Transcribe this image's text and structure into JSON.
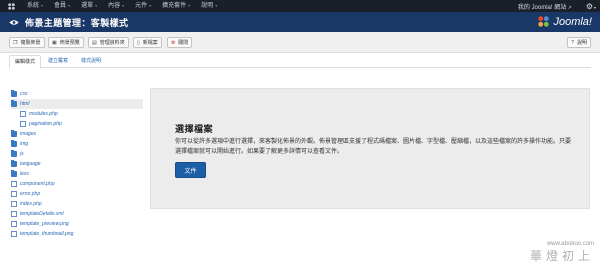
{
  "topbar": {
    "menu": [
      "系統",
      "會員",
      "選單",
      "內容",
      "元件",
      "擴充套件",
      "說明"
    ],
    "site_link": "我的 Joomla! 網站"
  },
  "header": {
    "title": "佈景主題管理：客製樣式",
    "brand": "Joomla!"
  },
  "toolbar": {
    "buttons": [
      {
        "icon": "copy-icon",
        "label": "複製佈景"
      },
      {
        "icon": "preview-icon",
        "label": "佈景預覽"
      },
      {
        "icon": "folder-icon",
        "label": "管理資料夾"
      },
      {
        "icon": "new-file-icon",
        "label": "新檔案"
      },
      {
        "icon": "close-icon",
        "label": "關閉"
      }
    ],
    "help": "說明"
  },
  "tabs": [
    "編輯樣式",
    "建立覆寫",
    "樣式說明"
  ],
  "tree": [
    {
      "type": "folder",
      "name": "css",
      "depth": 0,
      "selected": false
    },
    {
      "type": "folder",
      "name": "html",
      "depth": 0,
      "selected": true
    },
    {
      "type": "file",
      "name": "modules.php",
      "depth": 1,
      "selected": false
    },
    {
      "type": "file",
      "name": "pagination.php",
      "depth": 1,
      "selected": false
    },
    {
      "type": "folder",
      "name": "images",
      "depth": 0,
      "selected": false
    },
    {
      "type": "folder",
      "name": "img",
      "depth": 0,
      "selected": false
    },
    {
      "type": "folder",
      "name": "js",
      "depth": 0,
      "selected": false
    },
    {
      "type": "folder",
      "name": "language",
      "depth": 0,
      "selected": false
    },
    {
      "type": "folder",
      "name": "less",
      "depth": 0,
      "selected": false
    },
    {
      "type": "file",
      "name": "component.php",
      "depth": 0,
      "selected": false
    },
    {
      "type": "file",
      "name": "error.php",
      "depth": 0,
      "selected": false
    },
    {
      "type": "file",
      "name": "index.php",
      "depth": 0,
      "selected": false
    },
    {
      "type": "file",
      "name": "templateDetails.xml",
      "depth": 0,
      "selected": false
    },
    {
      "type": "file",
      "name": "template_preview.png",
      "depth": 0,
      "selected": false
    },
    {
      "type": "file",
      "name": "template_thumbnail.png",
      "depth": 0,
      "selected": false
    }
  ],
  "panel": {
    "heading": "選擇檔案",
    "body": "你可以從許多選項中進行選擇，來客製化佈景的外觀。佈景管理區支援了程式碼檔案、圖片檔、字型檔、壓縮檔，以及這些檔案的許多操作功能。只要選擇檔案就可以開始進行。如果要了解更多詳情可以查看文件。",
    "button": "文件"
  },
  "watermark": {
    "url": "www.abokuo.com",
    "text": "華燈初上"
  },
  "colors": {
    "topbar": "#1b1f27",
    "header": "#1a3867",
    "primary_button": "#1d5fa6",
    "link": "#2a69b8"
  }
}
